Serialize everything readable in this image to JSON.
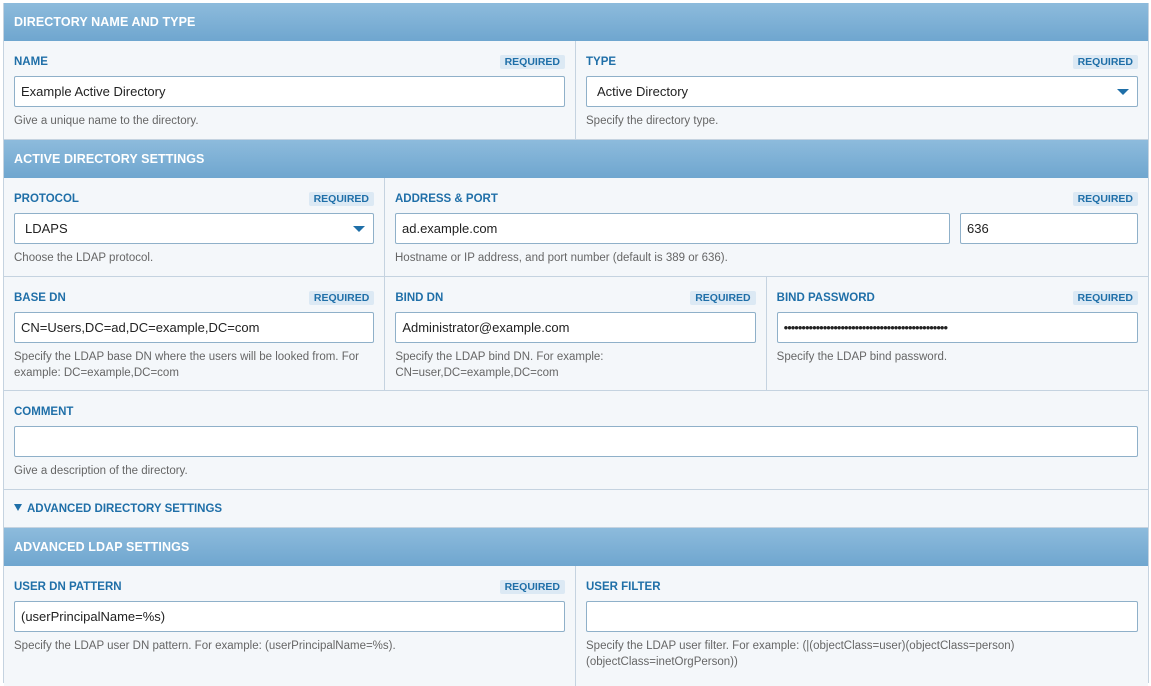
{
  "section_directory": {
    "title": "DIRECTORY NAME AND TYPE"
  },
  "name": {
    "label": "NAME",
    "required": "REQUIRED",
    "value": "Example Active Directory",
    "help": "Give a unique name to the directory."
  },
  "type": {
    "label": "TYPE",
    "required": "REQUIRED",
    "value": "Active Directory",
    "help": "Specify the directory type."
  },
  "section_ad": {
    "title": "ACTIVE DIRECTORY SETTINGS"
  },
  "protocol": {
    "label": "PROTOCOL",
    "required": "REQUIRED",
    "value": "LDAPS",
    "help": "Choose the LDAP protocol."
  },
  "address": {
    "label": "ADDRESS & PORT",
    "required": "REQUIRED",
    "host": "ad.example.com",
    "port": "636",
    "help": "Hostname or IP address, and port number (default is 389 or 636)."
  },
  "base_dn": {
    "label": "BASE DN",
    "required": "REQUIRED",
    "value": "CN=Users,DC=ad,DC=example,DC=com",
    "help": "Specify the LDAP base DN where the users will be looked from. For example: DC=example,DC=com"
  },
  "bind_dn": {
    "label": "BIND DN",
    "required": "REQUIRED",
    "value": "Administrator@example.com",
    "help": "Specify the LDAP bind DN. For example: CN=user,DC=example,DC=com"
  },
  "bind_password": {
    "label": "BIND PASSWORD",
    "required": "REQUIRED",
    "value": "••••••••••••••••••••••••••••••••••••••••••••••",
    "help": "Specify the LDAP bind password."
  },
  "comment": {
    "label": "COMMENT",
    "value": "",
    "help": "Give a description of the directory."
  },
  "advanced_toggle": {
    "label": "ADVANCED DIRECTORY SETTINGS"
  },
  "section_ldap": {
    "title": "ADVANCED LDAP SETTINGS"
  },
  "user_dn_pattern": {
    "label": "USER DN PATTERN",
    "required": "REQUIRED",
    "value": "(userPrincipalName=%s)",
    "help": "Specify the LDAP user DN pattern. For example: (userPrincipalName=%s)."
  },
  "user_filter": {
    "label": "USER FILTER",
    "value": "",
    "help": "Specify the LDAP user filter. For example: (|(objectClass=user)(objectClass=person)(objectClass=inetOrgPerson))"
  },
  "colors": {
    "header": "#7fb1d6",
    "accent": "#1f6fa8",
    "background": "#f4f7fa",
    "border": "#c5d3e0"
  }
}
